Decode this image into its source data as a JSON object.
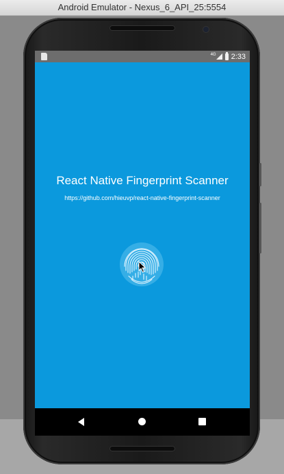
{
  "window": {
    "title": "Android Emulator - Nexus_6_API_25:5554"
  },
  "statusbar": {
    "network": "4G",
    "time": "2:33",
    "icons": [
      "sd-card-icon",
      "signal-icon",
      "battery-icon"
    ]
  },
  "app": {
    "title": "React Native Fingerprint Scanner",
    "link": "https://github.com/hieuvp/react-native-fingerprint-scanner",
    "background_color": "#0b99dd",
    "fingerprint_icon": "fingerprint-icon"
  },
  "navbar": {
    "icons": [
      "back-icon",
      "home-icon",
      "recents-icon"
    ]
  }
}
